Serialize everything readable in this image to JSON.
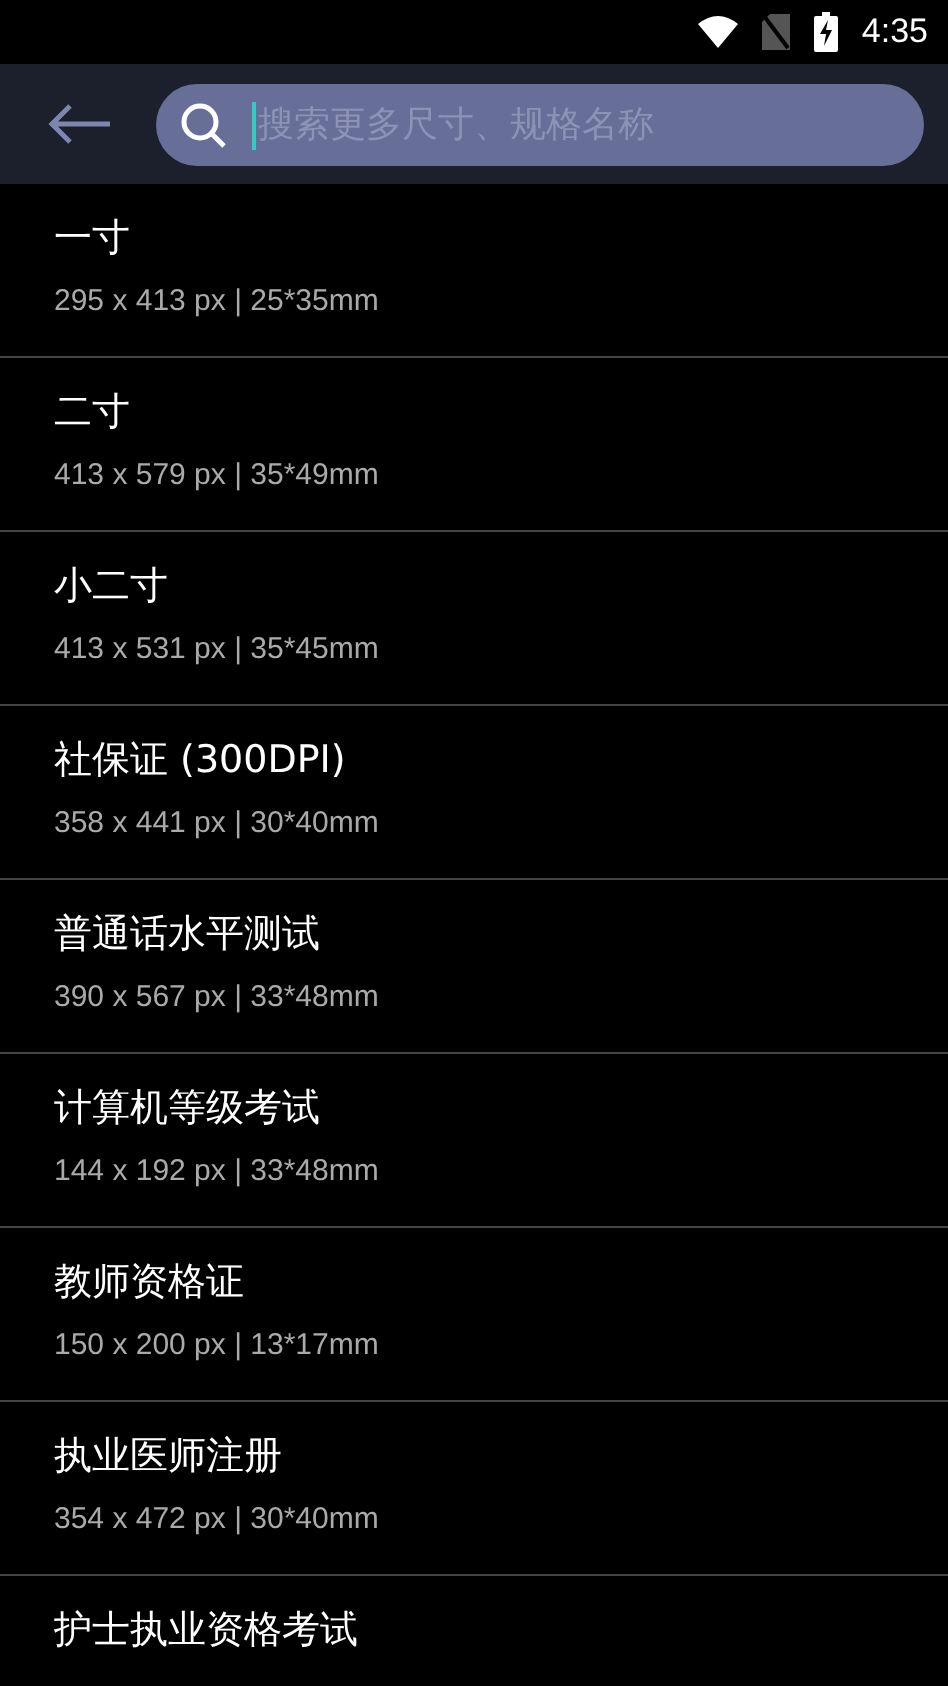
{
  "status_bar": {
    "time": "4:35"
  },
  "search": {
    "placeholder": "搜索更多尺寸、规格名称"
  },
  "items": [
    {
      "name": "一寸",
      "spec": "295 x 413 px | 25*35mm"
    },
    {
      "name": "二寸",
      "spec": "413 x 579 px | 35*49mm"
    },
    {
      "name": "小二寸",
      "spec": "413 x 531 px | 35*45mm"
    },
    {
      "name": "社保证 (300DPI)",
      "spec": "358 x 441 px | 30*40mm"
    },
    {
      "name": "普通话水平测试",
      "spec": "390 x 567 px | 33*48mm"
    },
    {
      "name": "计算机等级考试",
      "spec": "144 x 192 px | 33*48mm"
    },
    {
      "name": "教师资格证",
      "spec": "150 x 200 px | 13*17mm"
    },
    {
      "name": "执业医师注册",
      "spec": "354 x 472 px | 30*40mm"
    },
    {
      "name": "护士执业资格考试"
    }
  ]
}
